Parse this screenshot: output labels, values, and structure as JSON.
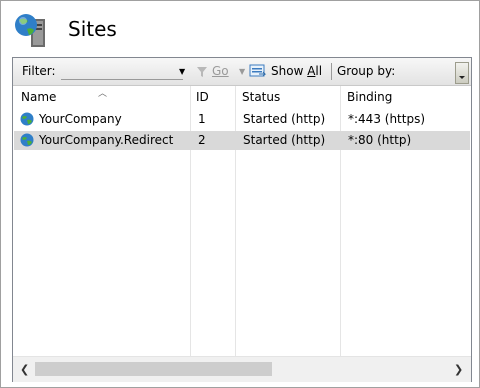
{
  "header": {
    "title": "Sites",
    "icon": "iis-server-globe-icon"
  },
  "toolbar": {
    "filter_label": "Filter:",
    "filter_value": "",
    "go_label": "Go",
    "show_all_label": "Show All",
    "group_by_label": "Group by:"
  },
  "columns": [
    "Name",
    "ID",
    "Status",
    "Binding"
  ],
  "rows": [
    {
      "name": "YourCompany",
      "id": "1",
      "status": "Started (http)",
      "binding": "*:443 (https)",
      "selected": false
    },
    {
      "name": "YourCompany.Redirect",
      "id": "2",
      "status": "Started (http)",
      "binding": "*:80 (http)",
      "selected": true
    }
  ],
  "colors": {
    "selected_row": "#d9d9d9",
    "toolbar_top": "#f7f7f7",
    "toolbar_bottom": "#e3e3e3"
  }
}
